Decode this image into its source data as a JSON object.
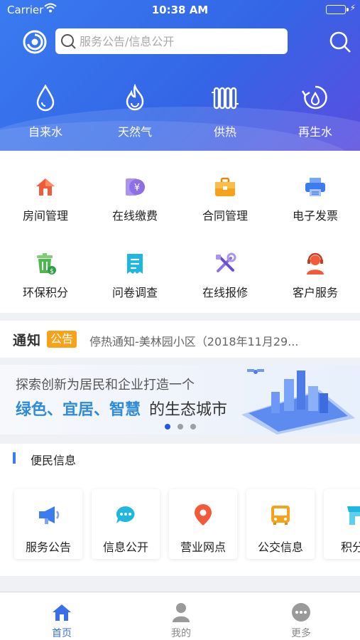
{
  "status_bar": {
    "carrier": "Carrier",
    "time": "10:38 AM"
  },
  "header": {
    "logo_icon": "swirl-logo-icon",
    "search_placeholder": "服务公告/信息公开",
    "search_button_icon": "search-icon"
  },
  "utilities": [
    {
      "label": "自来水",
      "icon": "water-drop-icon"
    },
    {
      "label": "天然气",
      "icon": "flame-icon"
    },
    {
      "label": "供热",
      "icon": "radiator-icon"
    },
    {
      "label": "再生水",
      "icon": "recycle-water-icon"
    }
  ],
  "services": [
    {
      "label": "房间管理",
      "icon": "house-icon",
      "color": "#f25a3a"
    },
    {
      "label": "在线缴费",
      "icon": "payment-icon",
      "color": "#8f6fe6"
    },
    {
      "label": "合同管理",
      "icon": "briefcase-icon",
      "color": "#f7a21b"
    },
    {
      "label": "电子发票",
      "icon": "printer-icon",
      "color": "#3b7cf0"
    },
    {
      "label": "环保积分",
      "icon": "recycle-bin-icon",
      "color": "#4cb84e"
    },
    {
      "label": "问卷调查",
      "icon": "receipt-icon",
      "color": "#1fb6e0"
    },
    {
      "label": "在线报修",
      "icon": "tools-icon",
      "color": "#8f6fe6"
    },
    {
      "label": "客户服务",
      "icon": "agent-icon",
      "color": "#f25a3a"
    }
  ],
  "notice": {
    "brand": "通知",
    "tag": "公告",
    "text": "停热通知-美林园小区（2018年11月29..."
  },
  "banner": {
    "line1": "探索创新为居民和企业打造一个",
    "highlight": "绿色、宜居、智慧",
    "tail": "的生态城市",
    "active_slide": 1,
    "slide_count": 3
  },
  "section": {
    "title": "便民信息"
  },
  "info_cards": [
    {
      "label": "服务公告",
      "icon": "megaphone-icon",
      "color": "#3b7cf0"
    },
    {
      "label": "信息公开",
      "icon": "chat-bubble-icon",
      "color": "#1fb6e0"
    },
    {
      "label": "营业网点",
      "icon": "location-pin-icon",
      "color": "#f25a3a"
    },
    {
      "label": "公交信息",
      "icon": "bus-icon",
      "color": "#f7a21b"
    },
    {
      "label": "积分兑",
      "icon": "shop-icon",
      "color": "#1fb6e0"
    }
  ],
  "tabs": [
    {
      "label": "首页",
      "icon": "home-icon",
      "active": true
    },
    {
      "label": "我的",
      "icon": "user-icon",
      "active": false
    },
    {
      "label": "更多",
      "icon": "more-icon",
      "active": false
    }
  ],
  "colors": {
    "header_start": "#3a7bf0",
    "header_end": "#5a4de0",
    "accent": "#3a6fe8",
    "banner_highlight": "#2e8bd9",
    "notice_tag": "#f7a21b"
  }
}
